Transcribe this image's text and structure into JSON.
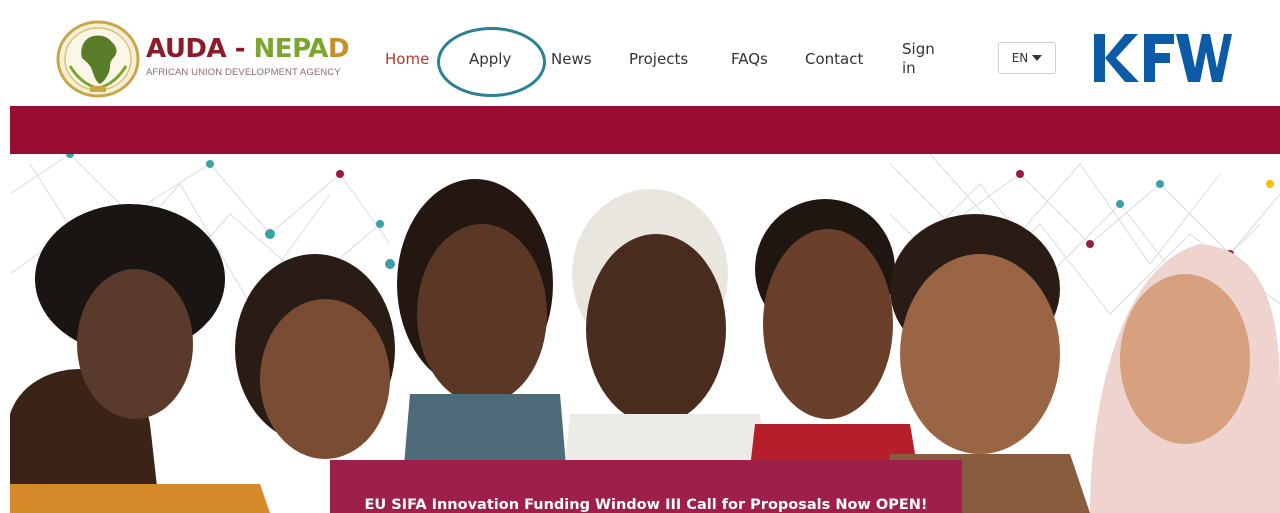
{
  "header": {
    "logo": {
      "title_part1": "AUDA",
      "title_sep": " - ",
      "title_part2": "NEPA",
      "title_part3": "D",
      "subtitle": "AFRICAN UNION DEVELOPMENT AGENCY",
      "icon": "african-union-emblem-icon"
    },
    "nav": [
      {
        "label": "Home"
      },
      {
        "label": "Apply"
      },
      {
        "label": "News"
      },
      {
        "label": "Projects"
      },
      {
        "label": "FAQs"
      },
      {
        "label": "Contact"
      },
      {
        "label": "Sign in"
      }
    ],
    "language": {
      "selected": "EN",
      "icon": "chevron-down-icon"
    },
    "partner_logo": {
      "text": "KFW",
      "icon": "kfw-logo-icon"
    }
  },
  "hero": {
    "banner_text": "EU SIFA Innovation Funding Window III Call for Proposals Now OPEN!"
  },
  "colors": {
    "band": "#9a0d33",
    "banner": "#9e1f49",
    "home_active": "#b23a2e",
    "annotation_circle": "#2d8091",
    "kfw_blue": "#0d5aa7"
  }
}
